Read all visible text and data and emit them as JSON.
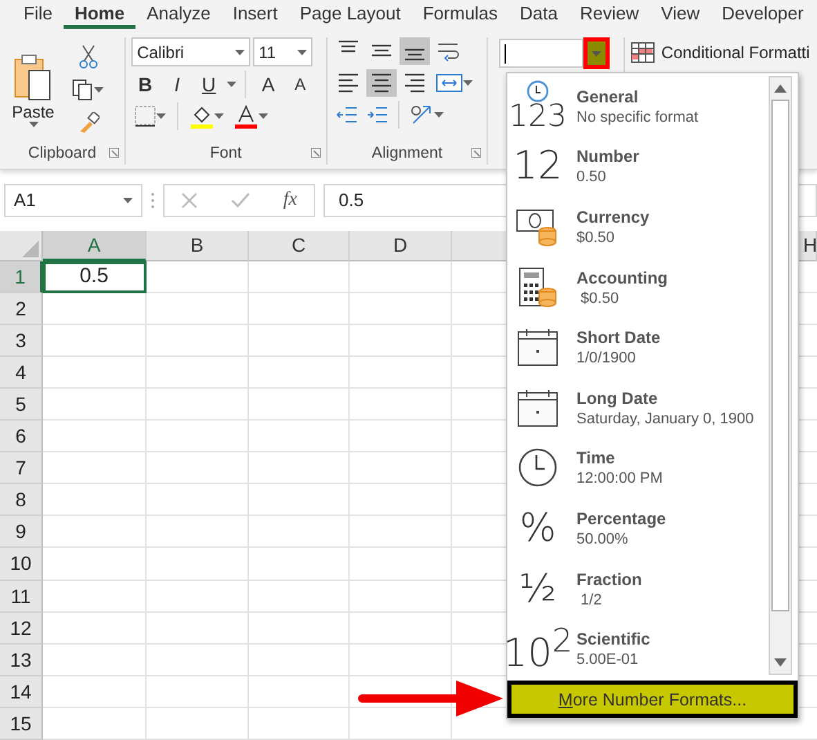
{
  "tabs": [
    {
      "label": "File",
      "selected": false
    },
    {
      "label": "Home",
      "selected": true
    },
    {
      "label": "Analyze",
      "selected": false
    },
    {
      "label": "Insert",
      "selected": false
    },
    {
      "label": "Page Layout",
      "selected": false
    },
    {
      "label": "Formulas",
      "selected": false
    },
    {
      "label": "Data",
      "selected": false
    },
    {
      "label": "Review",
      "selected": false
    },
    {
      "label": "View",
      "selected": false
    },
    {
      "label": "Developer",
      "selected": false
    }
  ],
  "ribbon": {
    "clipboard": {
      "paste_label": "Paste",
      "group_label": "Clipboard"
    },
    "font": {
      "font_name": "Calibri",
      "font_size": "11",
      "bold": "B",
      "italic": "I",
      "underline": "U",
      "grow": "A",
      "shrink": "A",
      "group_label": "Font"
    },
    "alignment": {
      "group_label": "Alignment",
      "buttons": [
        {
          "kind": "top",
          "selected": false
        },
        {
          "kind": "middle",
          "selected": false
        },
        {
          "kind": "bottom",
          "selected": true
        },
        {
          "kind": "left",
          "selected": false
        },
        {
          "kind": "center",
          "selected": true
        },
        {
          "kind": "right",
          "selected": false
        }
      ]
    },
    "number": {
      "dropdown_highlighted": true
    },
    "styles": {
      "conditional_formatting": "Conditional Formatti"
    }
  },
  "formula_bar": {
    "name_box": "A1",
    "insert_function": "fx",
    "value": "0.5"
  },
  "sheet": {
    "columns": [
      {
        "label": "A",
        "selected": true
      },
      {
        "label": "B",
        "selected": false
      },
      {
        "label": "C",
        "selected": false
      },
      {
        "label": "D",
        "selected": false
      }
    ],
    "right_column": "H",
    "rows": [
      {
        "label": "1",
        "selected": true,
        "cells": [
          "0.5"
        ]
      },
      {
        "label": "2",
        "selected": false
      },
      {
        "label": "3",
        "selected": false
      },
      {
        "label": "4",
        "selected": false
      },
      {
        "label": "5",
        "selected": false
      },
      {
        "label": "6",
        "selected": false
      },
      {
        "label": "7",
        "selected": false
      },
      {
        "label": "8",
        "selected": false
      },
      {
        "label": "9",
        "selected": false
      },
      {
        "label": "10",
        "selected": false
      },
      {
        "label": "11",
        "selected": false
      },
      {
        "label": "12",
        "selected": false
      },
      {
        "label": "13",
        "selected": false
      },
      {
        "label": "14",
        "selected": false
      },
      {
        "label": "15",
        "selected": false
      }
    ]
  },
  "format_menu": {
    "items": [
      {
        "kind": "general",
        "name": "General",
        "example": "No specific format",
        "glyph": "123"
      },
      {
        "kind": "number",
        "name": "Number",
        "example": "0.50",
        "glyph": "12"
      },
      {
        "kind": "currency",
        "name": "Currency",
        "example": "$0.50"
      },
      {
        "kind": "accounting",
        "name": "Accounting",
        "example": " $0.50"
      },
      {
        "kind": "short_date",
        "name": "Short Date",
        "example": "1/0/1900"
      },
      {
        "kind": "long_date",
        "name": "Long Date",
        "example": "Saturday, January 0, 1900"
      },
      {
        "kind": "time",
        "name": "Time",
        "example": "12:00:00 PM"
      },
      {
        "kind": "percentage",
        "name": "Percentage",
        "example": "50.00%",
        "glyph": "%"
      },
      {
        "kind": "fraction",
        "name": "Fraction",
        "example": " 1/2",
        "glyph": "½"
      },
      {
        "kind": "scientific",
        "name": "Scientific",
        "example": "5.00E-01",
        "glyph": "10$^{2}$"
      }
    ],
    "more_formats": {
      "label": "More Number Formats...",
      "highlighted": true
    }
  }
}
